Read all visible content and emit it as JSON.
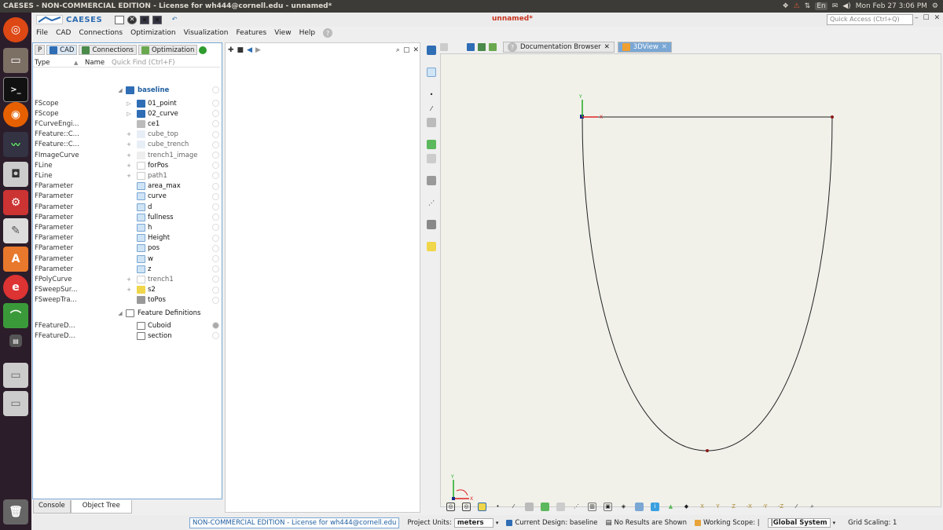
{
  "topbar": {
    "title": "CAESES - NON-COMMERCIAL EDITION - License for wh444@cornell.edu - unnamed*",
    "lang": "En",
    "clock": "Mon Feb 27  3:06 PM"
  },
  "app": {
    "brand": "CAESES",
    "doc_title": "unnamed*",
    "quick_access_placeholder": "Quick Access (Ctrl+Q)"
  },
  "menu": [
    "File",
    "CAD",
    "Connections",
    "Optimization",
    "Visualization",
    "Features",
    "View",
    "Help"
  ],
  "tabs": {
    "p": "P",
    "cad": "CAD",
    "connections": "Connections",
    "optimization": "Optimization"
  },
  "tree": {
    "col_type": "Type",
    "col_name": "Name",
    "quick_find": "Quick Find (Ctrl+F)",
    "baseline": "baseline",
    "feature_definitions": "Feature Definitions",
    "rows": [
      {
        "type": "FScope",
        "name": "01_point"
      },
      {
        "type": "FScope",
        "name": "02_curve"
      },
      {
        "type": "FCurveEngi...",
        "name": "ce1"
      },
      {
        "type": "FFeature::C...",
        "name": "cube_top"
      },
      {
        "type": "FFeature::C...",
        "name": "cube_trench"
      },
      {
        "type": "FImageCurve",
        "name": "trench1_image"
      },
      {
        "type": "FLine",
        "name": "forPos"
      },
      {
        "type": "FLine",
        "name": "path1"
      },
      {
        "type": "FParameter",
        "name": "area_max"
      },
      {
        "type": "FParameter",
        "name": "curve"
      },
      {
        "type": "FParameter",
        "name": "d"
      },
      {
        "type": "FParameter",
        "name": "fullness"
      },
      {
        "type": "FParameter",
        "name": "h"
      },
      {
        "type": "FParameter",
        "name": "Height"
      },
      {
        "type": "FParameter",
        "name": "pos"
      },
      {
        "type": "FParameter",
        "name": "w"
      },
      {
        "type": "FParameter",
        "name": "z"
      },
      {
        "type": "FPolyCurve",
        "name": "trench1"
      },
      {
        "type": "FSweepSur...",
        "name": "s2"
      },
      {
        "type": "FSweepTra...",
        "name": "toPos"
      }
    ],
    "feature_rows": [
      {
        "type": "FFeatureD...",
        "name": "Cuboid"
      },
      {
        "type": "FFeatureD...",
        "name": "section"
      }
    ]
  },
  "bottom_tabs": {
    "console": "Console",
    "object_tree": "Object Tree"
  },
  "view_tabs": {
    "documentation": "Documentation Browser",
    "view3d": "3DView"
  },
  "viewport": {
    "axis_x": "X",
    "axis_y": "Y"
  },
  "statusbar": {
    "license": "NON-COMMERCIAL EDITION - License for wh444@cornell.edu",
    "project_units_label": "Project Units:",
    "project_units_value": "meters",
    "current_design": "Current Design: baseline",
    "results": "No Results are Shown",
    "working_scope": "Working Scope: |",
    "global_system": "|Global System",
    "grid_scaling": "Grid Scaling: 1"
  },
  "colors": {
    "accent": "#2c6cb0",
    "folder": "#2f6db5",
    "parameter": "#f0d64a",
    "launcher": "#2c1d2a"
  }
}
